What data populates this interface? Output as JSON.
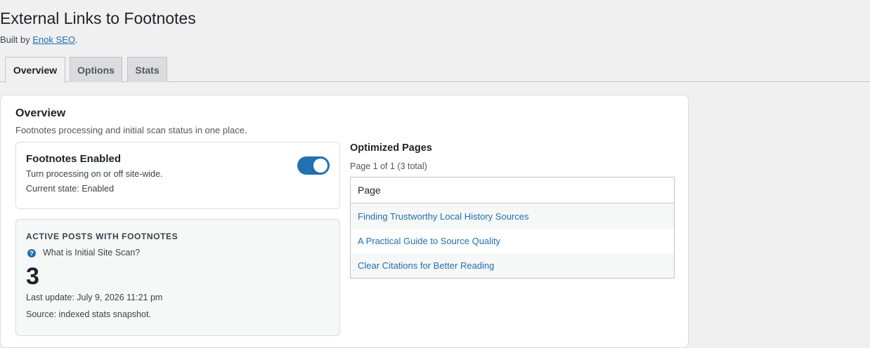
{
  "header": {
    "title": "External Links to Footnotes",
    "built_by_prefix": "Built by ",
    "built_by_link": "Enok SEO",
    "built_by_suffix": "."
  },
  "tabs": [
    {
      "label": "Overview",
      "active": true
    },
    {
      "label": "Options",
      "active": false
    },
    {
      "label": "Stats",
      "active": false
    }
  ],
  "overview": {
    "title": "Overview",
    "description": "Footnotes processing and initial scan status in one place."
  },
  "footnotes_toggle": {
    "title": "Footnotes Enabled",
    "description": "Turn processing on or off site-wide.",
    "state_text": "Current state: Enabled",
    "enabled": true,
    "accent_color": "#2271b1"
  },
  "active_posts": {
    "heading": "ACTIVE POSTS WITH FOOTNOTES",
    "help_icon": "question-circle-icon",
    "help_glyph": "?",
    "help_label": "What is Initial Site Scan?",
    "count": "3",
    "last_update": "Last update: July 9, 2026 11:21 pm",
    "source": "Source: indexed stats snapshot."
  },
  "optimized_pages": {
    "title": "Optimized Pages",
    "pager": "Page 1 of 1 (3 total)",
    "column_header": "Page",
    "rows": [
      "Finding Trustworthy Local History Sources",
      "A Practical Guide to Source Quality",
      "Clear Citations for Better Reading"
    ]
  }
}
